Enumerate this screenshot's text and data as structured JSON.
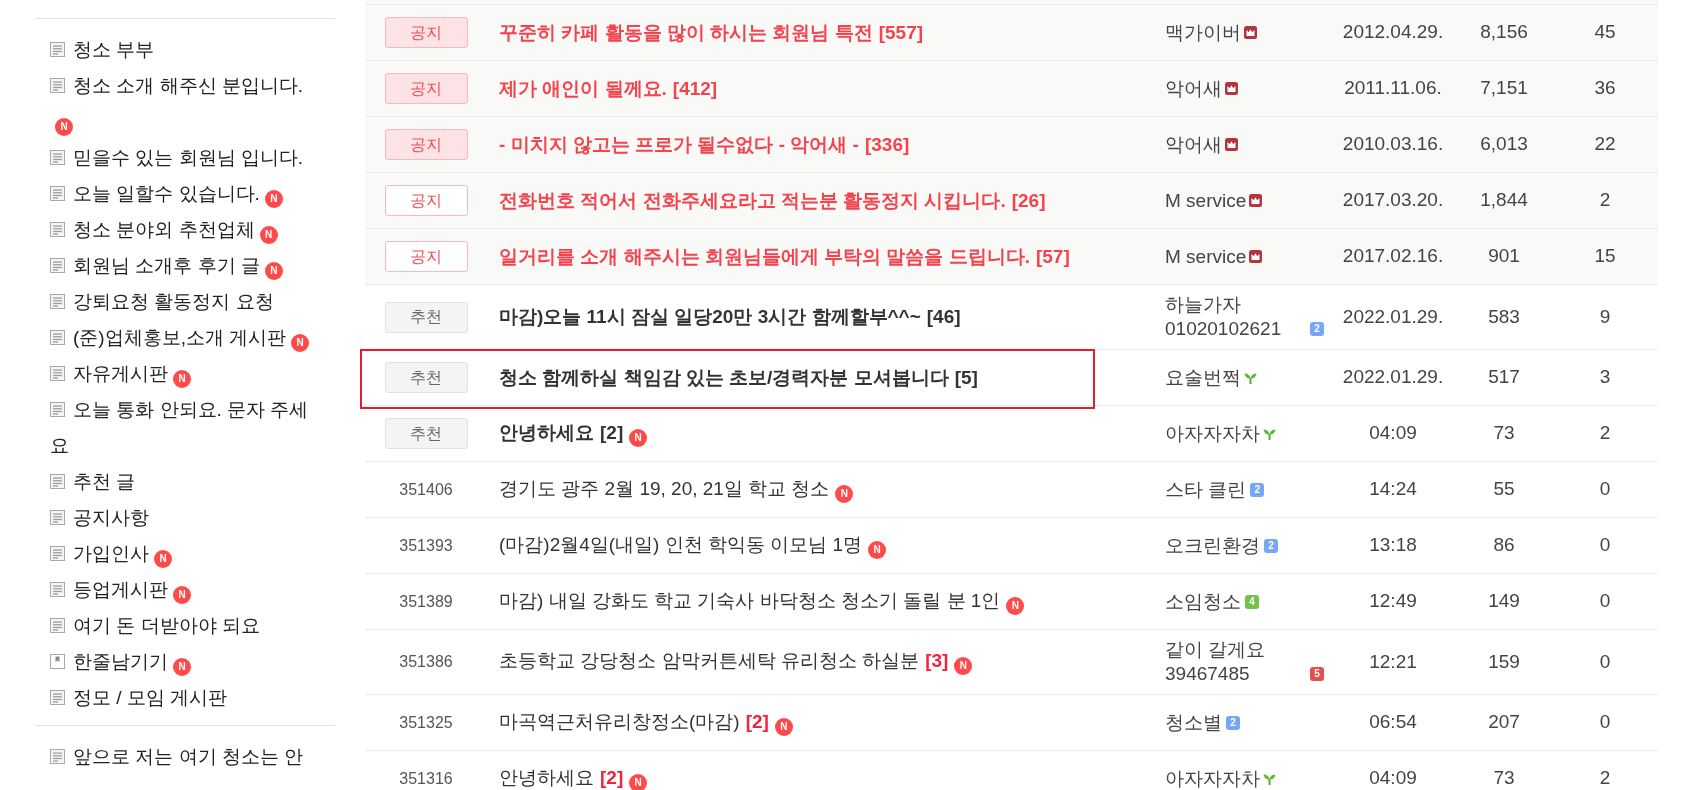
{
  "sidebar": {
    "menus": [
      {
        "label": "청소 부부",
        "kind": "board"
      },
      {
        "label": "청소 소개 해주신 분입니다.",
        "kind": "board",
        "new_badge": "N"
      },
      {
        "label": "믿을수 있는 회원님 입니다.",
        "kind": "board"
      },
      {
        "label": "오늘 일할수 있습니다.",
        "kind": "board",
        "new_badge": "N"
      },
      {
        "label": "청소 분야외 추천업체",
        "kind": "board",
        "new_badge": "N"
      },
      {
        "label": "회원님 소개후 후기 글",
        "kind": "board",
        "new_badge": "N"
      },
      {
        "label": "강퇴요청 활동정지 요청",
        "kind": "board"
      },
      {
        "label": "(준)업체홍보,소개 게시판",
        "kind": "board",
        "new_badge": "N"
      },
      {
        "label": "자유게시판",
        "kind": "board",
        "new_badge": "N"
      },
      {
        "label": "오늘 통화 안되요. 문자 주세요",
        "kind": "board"
      },
      {
        "label": "추천 글",
        "kind": "board"
      },
      {
        "label": "공지사항",
        "kind": "board"
      },
      {
        "label": "가입인사",
        "kind": "board",
        "new_badge": "N"
      },
      {
        "label": "등업게시판",
        "kind": "board",
        "new_badge": "N"
      },
      {
        "label": "여기 돈 더받아야 되요",
        "kind": "board"
      },
      {
        "label": "한줄남기기",
        "kind": "memo",
        "new_badge": "N"
      },
      {
        "label": "정모 / 모임 게시판",
        "kind": "board"
      }
    ],
    "extra_menus": [
      {
        "label": "앞으로 저는 여기 청소는 안",
        "kind": "board"
      }
    ]
  },
  "board": {
    "rows": [
      {
        "kind": "notice",
        "tag": "공지",
        "emphasized": true,
        "highlighted": false,
        "title": "꾸준히 카페 활동을 많이 하시는 회원님 특전",
        "comments": "[557]",
        "author": {
          "name": "맥가이버",
          "badge": {
            "kind": "manager"
          }
        },
        "date": "2012.04.29.",
        "views": "8,156",
        "likes": "45"
      },
      {
        "kind": "notice",
        "tag": "공지",
        "emphasized": true,
        "highlighted": false,
        "title": "제가 애인이 될께요.",
        "comments": "[412]",
        "author": {
          "name": "악어새",
          "badge": {
            "kind": "manager"
          }
        },
        "date": "2011.11.06.",
        "views": "7,151",
        "likes": "36"
      },
      {
        "kind": "notice",
        "tag": "공지",
        "emphasized": true,
        "highlighted": false,
        "title": "- 미치지 않고는 프로가 될수없다 - 악어새 -",
        "comments": "[336]",
        "author": {
          "name": "악어새",
          "badge": {
            "kind": "manager"
          }
        },
        "date": "2010.03.16.",
        "views": "6,013",
        "likes": "22"
      },
      {
        "kind": "notice",
        "tag": "공지",
        "emphasized": false,
        "highlighted": false,
        "title": "전화번호 적어서 전화주세요라고 적는분 활동정지 시킵니다.",
        "comments": "[26]",
        "author": {
          "name": "M service",
          "badge": {
            "kind": "manager"
          }
        },
        "date": "2017.03.20.",
        "views": "1,844",
        "likes": "2"
      },
      {
        "kind": "notice",
        "tag": "공지",
        "emphasized": false,
        "highlighted": false,
        "title": "일거리를 소개 해주시는 회원님들에게 부탁의 말씀을 드립니다.",
        "comments": "[57]",
        "author": {
          "name": "M service",
          "badge": {
            "kind": "manager"
          }
        },
        "date": "2017.02.16.",
        "views": "901",
        "likes": "15"
      },
      {
        "kind": "recommended",
        "tag": "추천",
        "highlighted": false,
        "title": "마감)오늘 11시 잠실 일당20만 3시간 함께할부^^~",
        "comments": "[46]",
        "author": {
          "name": "하늘가자 01020102621",
          "badge": {
            "kind": "grade",
            "text": "2",
            "color": "#78a6f6"
          }
        },
        "date": "2022.01.29.",
        "views": "583",
        "likes": "9"
      },
      {
        "kind": "recommended",
        "tag": "추천",
        "highlighted": true,
        "title": "청소 함께하실 책임감 있는 초보/경력자분 모셔봅니다",
        "comments": "[5]",
        "author": {
          "name": "요술번쩍",
          "badge": {
            "kind": "sprout"
          }
        },
        "date": "2022.01.29.",
        "views": "517",
        "likes": "3"
      },
      {
        "kind": "recommended",
        "tag": "추천",
        "highlighted": false,
        "title": "안녕하세요",
        "comments": "[2]",
        "new_badge": "N",
        "author": {
          "name": "아자자자차",
          "badge": {
            "kind": "sprout"
          }
        },
        "date": "04:09",
        "views": "73",
        "likes": "2"
      },
      {
        "kind": "post",
        "number": "351406",
        "highlighted": false,
        "title": "경기도 광주 2월 19, 20, 21일 학교 청소",
        "new_badge": "N",
        "author": {
          "name": "스타 클린",
          "badge": {
            "kind": "grade",
            "text": "2",
            "color": "#78a6f6"
          }
        },
        "date": "14:24",
        "views": "55",
        "likes": "0"
      },
      {
        "kind": "post",
        "number": "351393",
        "highlighted": false,
        "title": "(마감)2월4일(내일) 인천 학익동 이모님 1명",
        "new_badge": "N",
        "author": {
          "name": "오크린환경",
          "badge": {
            "kind": "grade",
            "text": "2",
            "color": "#78a6f6"
          }
        },
        "date": "13:18",
        "views": "86",
        "likes": "0"
      },
      {
        "kind": "post",
        "number": "351389",
        "highlighted": false,
        "title": "마감) 내일 강화도 학교 기숙사 바닥청소 청소기 돌릴 분 1인",
        "new_badge": "N",
        "author": {
          "name": "소임청소",
          "badge": {
            "kind": "grade",
            "text": "4",
            "color": "#72c24a"
          }
        },
        "date": "12:49",
        "views": "149",
        "likes": "0"
      },
      {
        "kind": "post",
        "number": "351386",
        "highlighted": false,
        "title": "초등학교 강당청소 암막커튼세탁 유리청소 하실분",
        "comments": "[3]",
        "new_badge": "N",
        "author": {
          "name": "같이 갈게요 39467485",
          "badge": {
            "kind": "grade",
            "text": "5",
            "color": "#e0504f"
          }
        },
        "date": "12:21",
        "views": "159",
        "likes": "0"
      },
      {
        "kind": "post",
        "number": "351325",
        "highlighted": false,
        "title": "마곡역근처유리창정소(마감)",
        "comments": "[2]",
        "new_badge": "N",
        "author": {
          "name": "청소별",
          "badge": {
            "kind": "grade",
            "text": "2",
            "color": "#78a6f6"
          }
        },
        "date": "06:54",
        "views": "207",
        "likes": "0"
      },
      {
        "kind": "post",
        "number": "351316",
        "highlighted": false,
        "title": "안녕하세요",
        "comments": "[2]",
        "new_badge": "N",
        "author": {
          "name": "아자자자차",
          "badge": {
            "kind": "sprout"
          }
        },
        "date": "04:09",
        "views": "73",
        "likes": "2"
      }
    ]
  }
}
